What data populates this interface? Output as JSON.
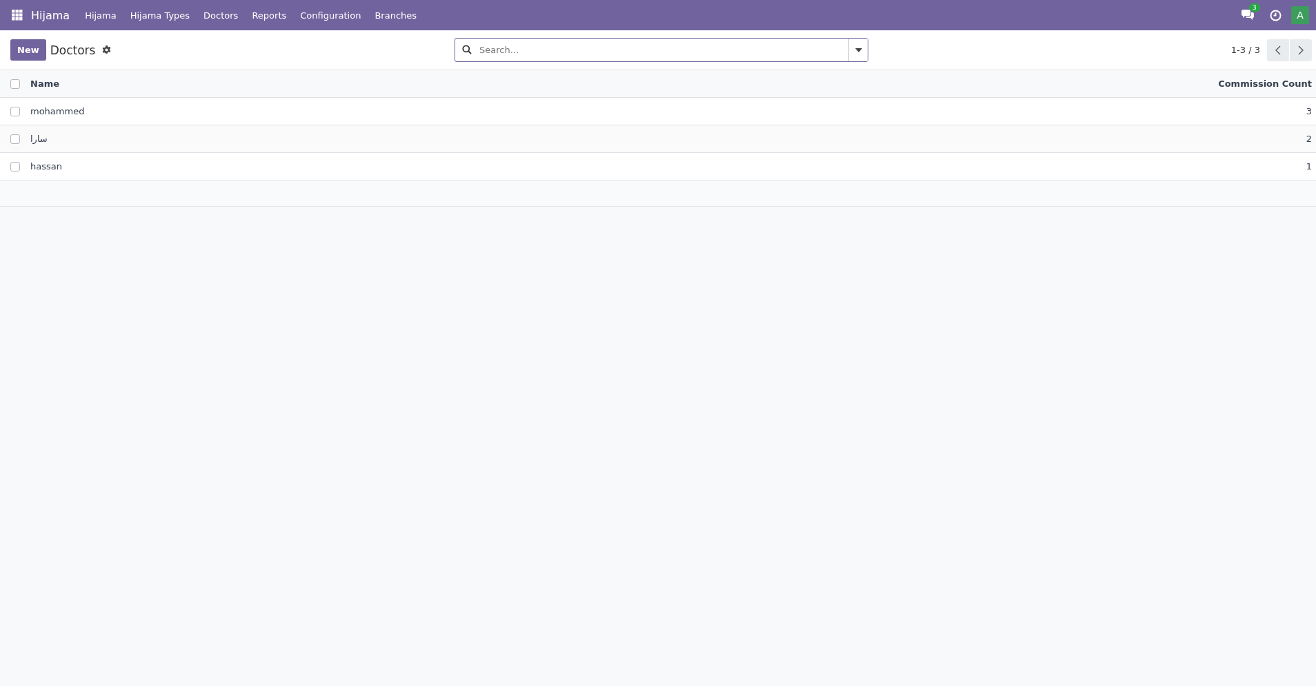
{
  "navbar": {
    "app_name": "Hijama",
    "menu": [
      {
        "label": "Hijama"
      },
      {
        "label": "Hijama Types"
      },
      {
        "label": "Doctors"
      },
      {
        "label": "Reports"
      },
      {
        "label": "Configuration"
      },
      {
        "label": "Branches"
      }
    ],
    "messages_count": "3",
    "avatar": "A"
  },
  "control_panel": {
    "new_button": "New",
    "title": "Doctors",
    "search": {
      "placeholder": "Search..."
    },
    "pager": "1-3 / 3"
  },
  "table": {
    "select_all_checked": false,
    "columns": [
      "Name",
      "Commission Count"
    ],
    "rows": [
      {
        "checked": false,
        "name": "mohammed",
        "commission_count": "3"
      },
      {
        "checked": false,
        "name": "سارا",
        "commission_count": "2"
      },
      {
        "checked": false,
        "name": "hassan",
        "commission_count": "1"
      }
    ]
  }
}
